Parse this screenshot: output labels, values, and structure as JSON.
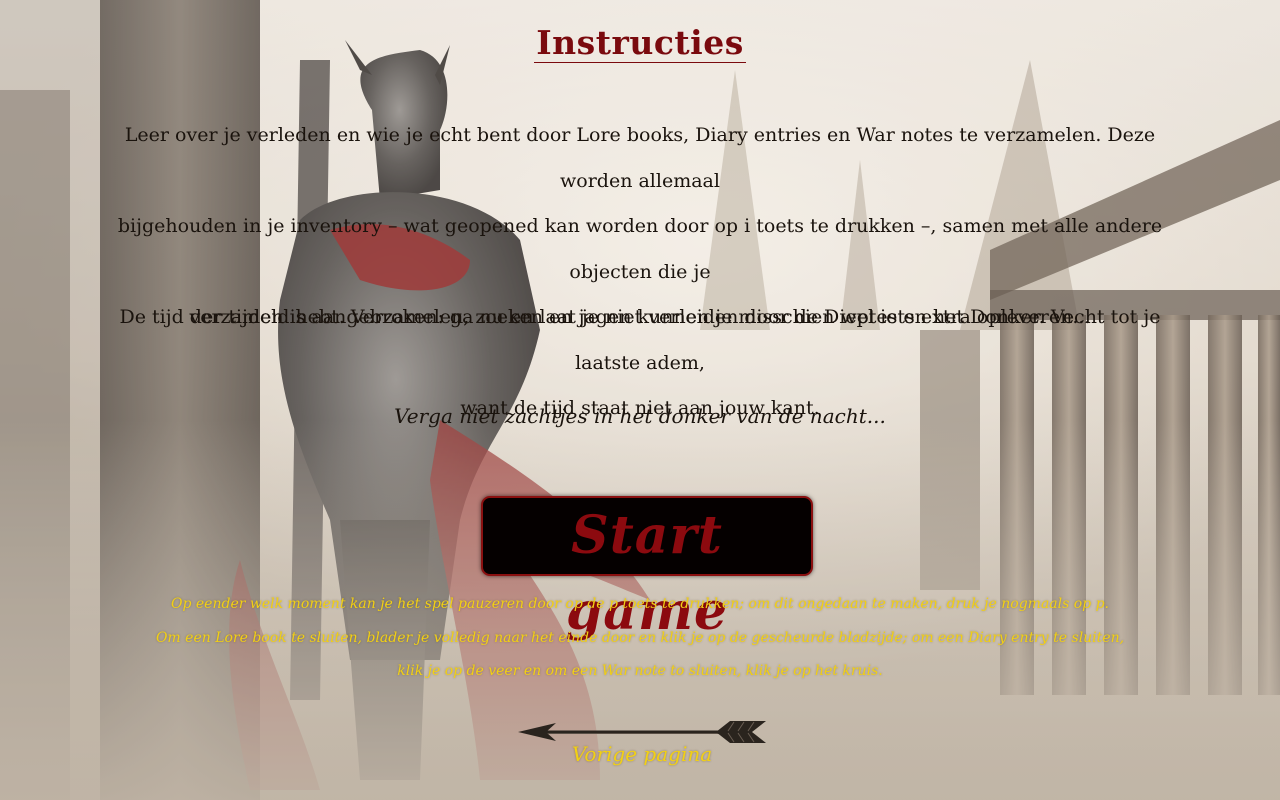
{
  "page": {
    "title": "Instructies",
    "paragraphs": {
      "lore": {
        "line1": "Leer over je verleden en wie je echt bent door Lore books, Diary entries en War notes te verzamelen. Deze worden allemaal",
        "line2": "bijgehouden in je inventory – wat geopened kan worden door op i toets te drukken –, samen met alle andere objecten die je",
        "line3": "verzameld hebt. Verzamelen, zoeken en jagen kunnen je misschien wel iets extra opleveren..."
      },
      "time": {
        "line1": "De tijd der tijden is aangebroken: ga nu en laat je niet verleiden door de Dieptes en het Donker. Vecht tot je laatste adem,",
        "line2": "want de tijd staat niet aan jouw kant."
      }
    },
    "tagline": "Verga niet zachtjes in het donker van de nacht...",
    "start_button": "Start game",
    "notes": {
      "line1": "Op eender welk moment kan je het spel pauzeren door op de p toets te drukken; om dit ongedaan te maken, druk je nogmaals op p.",
      "line2": "Om een Lore book te sluiten, blader je volledig naar het einde door en klik je op de gescheurde bladzijde; om een Diary entry te sluiten,",
      "line3": "klik je op de veer en om een War note to sluiten, klik je op het kruis."
    },
    "back_link": {
      "label": "Vorige pagina",
      "icon": "arrow-left-icon"
    }
  },
  "theme": {
    "title_color": "#7a0a0e",
    "body_text_color": "#1a130d",
    "accent_yellow": "#f2d014",
    "button_bg": "#050000",
    "button_text": "#8c0a0f"
  }
}
